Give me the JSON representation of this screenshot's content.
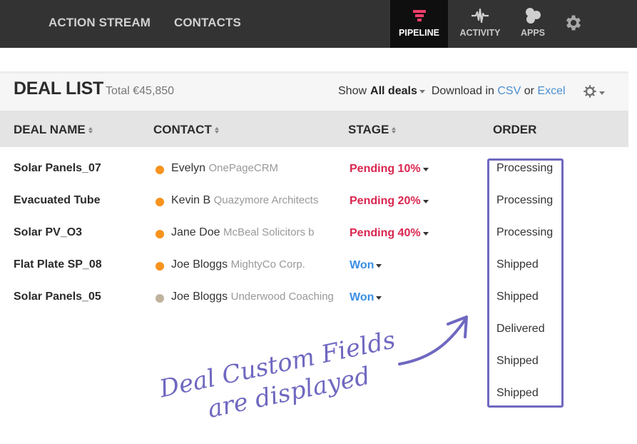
{
  "topnav": {
    "left_items": [
      {
        "label": "ACTION STREAM"
      },
      {
        "label": "CONTACTS"
      }
    ],
    "right_items": [
      {
        "label": "PIPELINE",
        "icon": "funnel-icon",
        "active": true
      },
      {
        "label": "ACTIVITY",
        "icon": "pulse-icon",
        "active": false
      },
      {
        "label": "APPS",
        "icon": "apps-bubbles-icon",
        "active": false
      },
      {
        "label": "",
        "icon": "gear-icon",
        "active": false
      }
    ],
    "accent_color": "#ee3d6a"
  },
  "page": {
    "title": "DEAL LIST",
    "total": "Total €45,850"
  },
  "toolbar": {
    "show_label": "Show",
    "filter_value": "All deals",
    "download_label": "Download in",
    "csv_link": "CSV",
    "or_label": "or",
    "excel_link": "Excel"
  },
  "table": {
    "columns": [
      "DEAL NAME",
      "CONTACT",
      "STAGE",
      "ORDER"
    ],
    "rows": [
      {
        "deal": "Solar Panels_07",
        "contact": "Evelyn",
        "company": "OnePageCRM",
        "dot_color": "#f7931e",
        "stage": "Pending 10%",
        "stage_color": "#d9264f"
      },
      {
        "deal": "Evacuated Tube",
        "contact": "Kevin B",
        "company": "Quazymore Architects",
        "dot_color": "#f7931e",
        "stage": "Pending 20%",
        "stage_color": "#d9264f"
      },
      {
        "deal": "Solar PV_O3",
        "contact": "Jane Doe",
        "company": "McBeal Solicitors  b",
        "dot_color": "#f7931e",
        "stage": "Pending 40%",
        "stage_color": "#d9264f"
      },
      {
        "deal": "Flat Plate SP_08",
        "contact": "Joe Bloggs",
        "company": "MightyCo Corp.",
        "dot_color": "#f7931e",
        "stage": "Won",
        "stage_color": "#3a8ee6"
      },
      {
        "deal": "Solar Panels_05",
        "contact": "Joe Bloggs",
        "company": "Underwood Coaching",
        "dot_color": "#bfb39d",
        "stage": "Won",
        "stage_color": "#3a8ee6"
      }
    ],
    "order_values": [
      "Processing",
      "Processing",
      "Processing",
      "Shipped",
      "Shipped",
      "Delivered",
      "Shipped",
      "Shipped"
    ]
  },
  "annotation": {
    "line1": "Deal Custom Fields",
    "line2": "are displayed",
    "color": "#6f68c0"
  }
}
